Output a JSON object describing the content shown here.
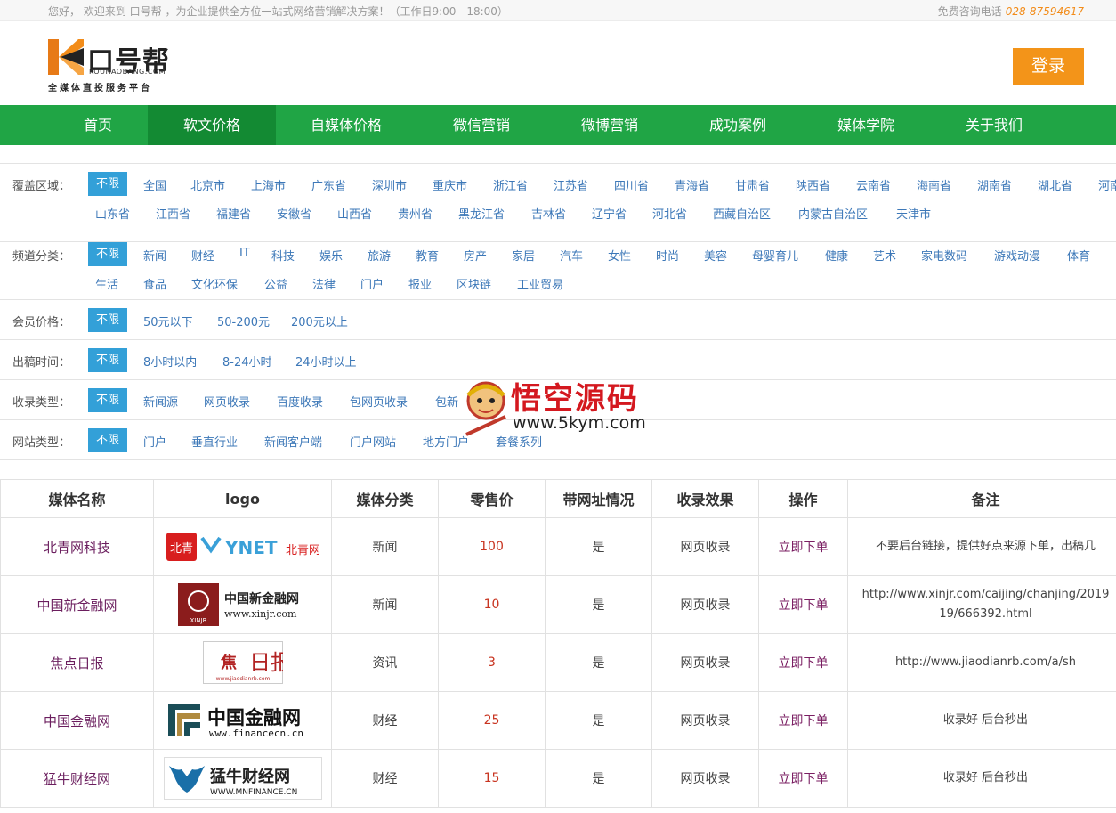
{
  "topbar": {
    "welcome": "您好， 欢迎来到 口号帮 ，为企业提供全方位一站式网络营销解决方案！（工作日9:00 - 18:00）",
    "hotline_label": "免费咨询电话",
    "hotline_number": "028-87594617"
  },
  "logo": {
    "name": "口号帮",
    "domain": "KOUHAOBANG.COM",
    "slogan": "全媒体直投服务平台"
  },
  "header": {
    "login_label": "登录"
  },
  "nav": [
    "首页",
    "软文价格",
    "自媒体价格",
    "微信营销",
    "微博营销",
    "成功案例",
    "媒体学院",
    "关于我们"
  ],
  "filters": {
    "region": {
      "label": "覆盖区域：",
      "selected": "不限",
      "row1": [
        "全国",
        "北京市",
        "上海市",
        "广东省",
        "深圳市",
        "重庆市",
        "浙江省",
        "江苏省",
        "四川省",
        "青海省",
        "甘肃省",
        "陕西省",
        "云南省",
        "海南省",
        "湖南省",
        "湖北省",
        "河南"
      ],
      "row2": [
        "山东省",
        "江西省",
        "福建省",
        "安徽省",
        "山西省",
        "贵州省",
        "黑龙江省",
        "吉林省",
        "辽宁省",
        "河北省",
        "西藏自治区",
        "内蒙古自治区",
        "天津市"
      ]
    },
    "channel": {
      "label": "频道分类：",
      "selected": "不限",
      "row1": [
        "新闻",
        "财经",
        "IT",
        "科技",
        "娱乐",
        "旅游",
        "教育",
        "房产",
        "家居",
        "汽车",
        "女性",
        "时尚",
        "美容",
        "母婴育儿",
        "健康",
        "艺术",
        "家电数码",
        "游戏动漫",
        "体育"
      ],
      "row2": [
        "生活",
        "食品",
        "文化环保",
        "公益",
        "法律",
        "门户",
        "报业",
        "区块链",
        "工业贸易"
      ]
    },
    "price": {
      "label": "会员价格：",
      "selected": "不限",
      "options": [
        "50元以下",
        "50-200元",
        "200元以上"
      ]
    },
    "time": {
      "label": "出稿时间：",
      "selected": "不限",
      "options": [
        "8小时以内",
        "8-24小时",
        "24小时以上"
      ]
    },
    "index": {
      "label": "收录类型：",
      "selected": "不限",
      "options": [
        "新闻源",
        "网页收录",
        "百度收录",
        "包网页收录",
        "包新"
      ]
    },
    "site": {
      "label": "网站类型：",
      "selected": "不限",
      "options": [
        "门户",
        "垂直行业",
        "新闻客户端",
        "门户网站",
        "地方门户",
        "套餐系列"
      ]
    }
  },
  "table": {
    "headers": [
      "媒体名称",
      "logo",
      "媒体分类",
      "零售价",
      "带网址情况",
      "收录效果",
      "操作",
      "备注"
    ],
    "rows": [
      {
        "name": "北青网科技",
        "logo_text": "北青 YNET 北青网",
        "category": "新闻",
        "price": "100",
        "url": "是",
        "effect": "网页收录",
        "action": "立即下单",
        "note": "不要后台链接，提供好点来源下单，出稿几"
      },
      {
        "name": "中国新金融网",
        "logo_text": "中国新金融网 www.xinjr.com",
        "category": "新闻",
        "price": "10",
        "url": "是",
        "effect": "网页收录",
        "action": "立即下单",
        "note": "http://www.xinjr.com/caijing/chanjing/2019 19/666392.html"
      },
      {
        "name": "焦点日报",
        "logo_text": "焦点日报 www.jiaodianrb.com",
        "category": "资讯",
        "price": "3",
        "url": "是",
        "effect": "网页收录",
        "action": "立即下单",
        "note": "http://www.jiaodianrb.com/a/sh"
      },
      {
        "name": "中国金融网",
        "logo_text": "中国金融网 www.financecn.cn",
        "category": "财经",
        "price": "25",
        "url": "是",
        "effect": "网页收录",
        "action": "立即下单",
        "note": "收录好 后台秒出"
      },
      {
        "name": "猛牛财经网",
        "logo_text": "猛牛财经网 WWW.MNFINANCE.CN",
        "category": "财经",
        "price": "15",
        "url": "是",
        "effect": "网页收录",
        "action": "立即下单",
        "note": "收录好 后台秒出"
      }
    ]
  },
  "watermark": {
    "title": "悟空源码",
    "url": "www.5kym.com"
  },
  "colors": {
    "nav_green": "#20a545",
    "nav_active": "#138a33",
    "accent_orange": "#f39419",
    "filter_selected": "#33a0d8",
    "link_blue": "#3d78b8"
  }
}
